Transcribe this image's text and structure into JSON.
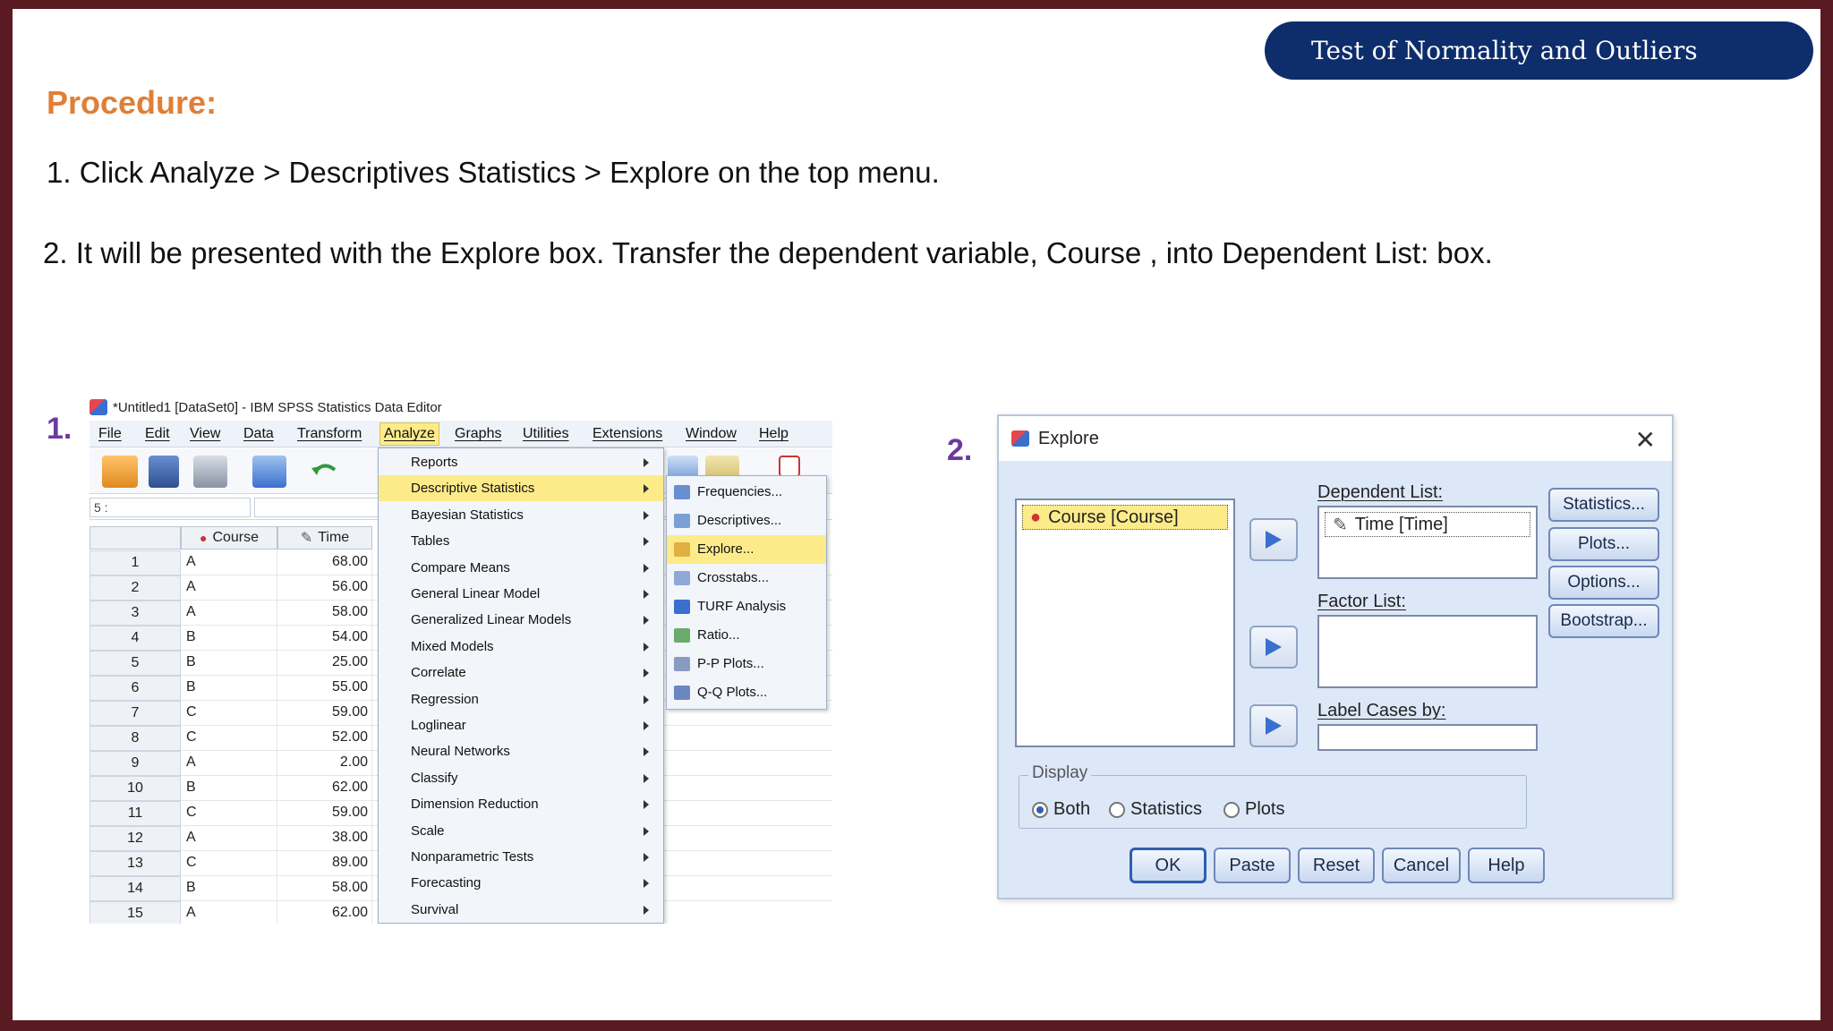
{
  "header": {
    "badge": "Test of Normality and Outliers"
  },
  "procedure": {
    "heading": "Procedure:",
    "step1": "1. Click Analyze > Descriptives Statistics > Explore on the top menu.",
    "step2": "2. It will be presented with the Explore box. Transfer the dependent variable, Course , into Dependent List: box."
  },
  "figure_labels": {
    "first": "1.",
    "second": "2."
  },
  "spss": {
    "window_title": "*Untitled1 [DataSet0] - IBM SPSS Statistics Data Editor",
    "menus": [
      "File",
      "Edit",
      "View",
      "Data",
      "Transform",
      "Analyze",
      "Graphs",
      "Utilities",
      "Extensions",
      "Window",
      "Help"
    ],
    "active_menu": "Analyze",
    "cell_ref": "5 :",
    "columns": [
      "Course",
      "Time"
    ],
    "rows": [
      {
        "n": "1",
        "course": "A",
        "time": "68.00"
      },
      {
        "n": "2",
        "course": "A",
        "time": "56.00"
      },
      {
        "n": "3",
        "course": "A",
        "time": "58.00"
      },
      {
        "n": "4",
        "course": "B",
        "time": "54.00"
      },
      {
        "n": "5",
        "course": "B",
        "time": "25.00"
      },
      {
        "n": "6",
        "course": "B",
        "time": "55.00"
      },
      {
        "n": "7",
        "course": "C",
        "time": "59.00"
      },
      {
        "n": "8",
        "course": "C",
        "time": "52.00"
      },
      {
        "n": "9",
        "course": "A",
        "time": "2.00"
      },
      {
        "n": "10",
        "course": "B",
        "time": "62.00"
      },
      {
        "n": "11",
        "course": "C",
        "time": "59.00"
      },
      {
        "n": "12",
        "course": "A",
        "time": "38.00"
      },
      {
        "n": "13",
        "course": "C",
        "time": "89.00"
      },
      {
        "n": "14",
        "course": "B",
        "time": "58.00"
      },
      {
        "n": "15",
        "course": "A",
        "time": "62.00"
      }
    ],
    "analyze_menu": [
      "Reports",
      "Descriptive Statistics",
      "Bayesian Statistics",
      "Tables",
      "Compare Means",
      "General Linear Model",
      "Generalized Linear Models",
      "Mixed Models",
      "Correlate",
      "Regression",
      "Loglinear",
      "Neural Networks",
      "Classify",
      "Dimension Reduction",
      "Scale",
      "Nonparametric Tests",
      "Forecasting",
      "Survival"
    ],
    "descriptives_submenu": [
      "Frequencies...",
      "Descriptives...",
      "Explore...",
      "Crosstabs...",
      "TURF Analysis",
      "Ratio...",
      "P-P Plots...",
      "Q-Q Plots..."
    ]
  },
  "explore": {
    "title": "Explore",
    "source_item": "Course [Course]",
    "dependent_label": "Dependent List:",
    "dependent_item": "Time [Time]",
    "factor_label": "Factor List:",
    "label_cases": "Label Cases by:",
    "side_buttons": [
      "Statistics...",
      "Plots...",
      "Options...",
      "Bootstrap..."
    ],
    "display_legend": "Display",
    "display_options": [
      "Both",
      "Statistics",
      "Plots"
    ],
    "bottom_buttons": [
      "OK",
      "Paste",
      "Reset",
      "Cancel",
      "Help"
    ]
  }
}
